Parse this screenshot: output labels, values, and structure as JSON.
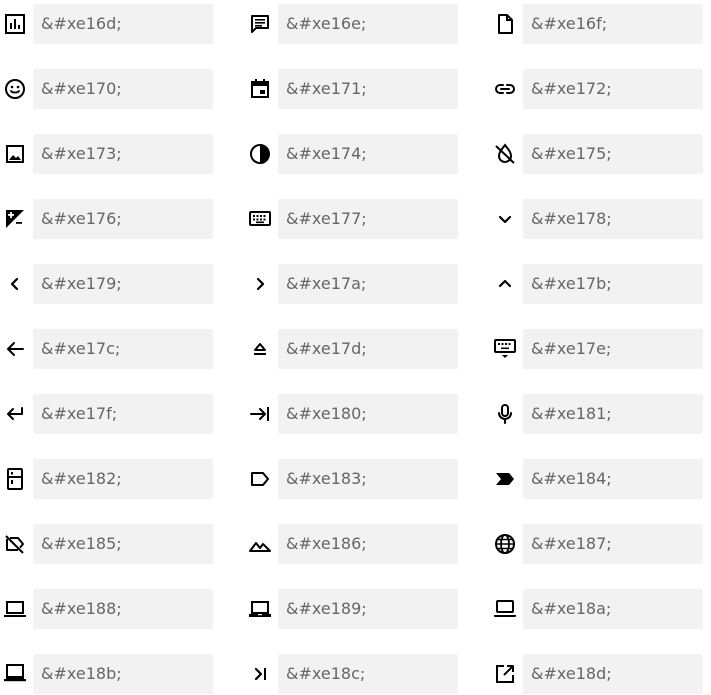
{
  "items": [
    {
      "icon": "bar-chart-icon",
      "code": "&#xe16d;"
    },
    {
      "icon": "comment-icon",
      "code": "&#xe16e;"
    },
    {
      "icon": "file-icon",
      "code": "&#xe16f;"
    },
    {
      "icon": "smiley-icon",
      "code": "&#xe170;"
    },
    {
      "icon": "calendar-icon",
      "code": "&#xe171;"
    },
    {
      "icon": "link-icon",
      "code": "&#xe172;"
    },
    {
      "icon": "image-icon",
      "code": "&#xe173;"
    },
    {
      "icon": "contrast-icon",
      "code": "&#xe174;"
    },
    {
      "icon": "ink-off-icon",
      "code": "&#xe175;"
    },
    {
      "icon": "exposure-icon",
      "code": "&#xe176;"
    },
    {
      "icon": "keyboard-icon",
      "code": "&#xe177;"
    },
    {
      "icon": "chevron-down-icon",
      "code": "&#xe178;"
    },
    {
      "icon": "chevron-left-icon",
      "code": "&#xe179;"
    },
    {
      "icon": "chevron-right-icon",
      "code": "&#xe17a;"
    },
    {
      "icon": "chevron-up-icon",
      "code": "&#xe17b;"
    },
    {
      "icon": "arrow-left-icon",
      "code": "&#xe17c;"
    },
    {
      "icon": "eject-icon",
      "code": "&#xe17d;"
    },
    {
      "icon": "keyboard-hide-icon",
      "code": "&#xe17e;"
    },
    {
      "icon": "return-icon",
      "code": "&#xe17f;"
    },
    {
      "icon": "tab-icon",
      "code": "&#xe180;"
    },
    {
      "icon": "microphone-icon",
      "code": "&#xe181;"
    },
    {
      "icon": "kitchen-icon",
      "code": "&#xe182;"
    },
    {
      "icon": "label-icon",
      "code": "&#xe183;"
    },
    {
      "icon": "label-important-icon",
      "code": "&#xe184;"
    },
    {
      "icon": "label-off-icon",
      "code": "&#xe185;"
    },
    {
      "icon": "landscape-icon",
      "code": "&#xe186;"
    },
    {
      "icon": "globe-icon",
      "code": "&#xe187;"
    },
    {
      "icon": "laptop-icon",
      "code": "&#xe188;"
    },
    {
      "icon": "laptop-chromebook-icon",
      "code": "&#xe189;"
    },
    {
      "icon": "laptop-mac-icon",
      "code": "&#xe18a;"
    },
    {
      "icon": "laptop-windows-icon",
      "code": "&#xe18b;"
    },
    {
      "icon": "last-page-icon",
      "code": "&#xe18c;"
    },
    {
      "icon": "open-in-new-icon",
      "code": "&#xe18d;"
    }
  ]
}
